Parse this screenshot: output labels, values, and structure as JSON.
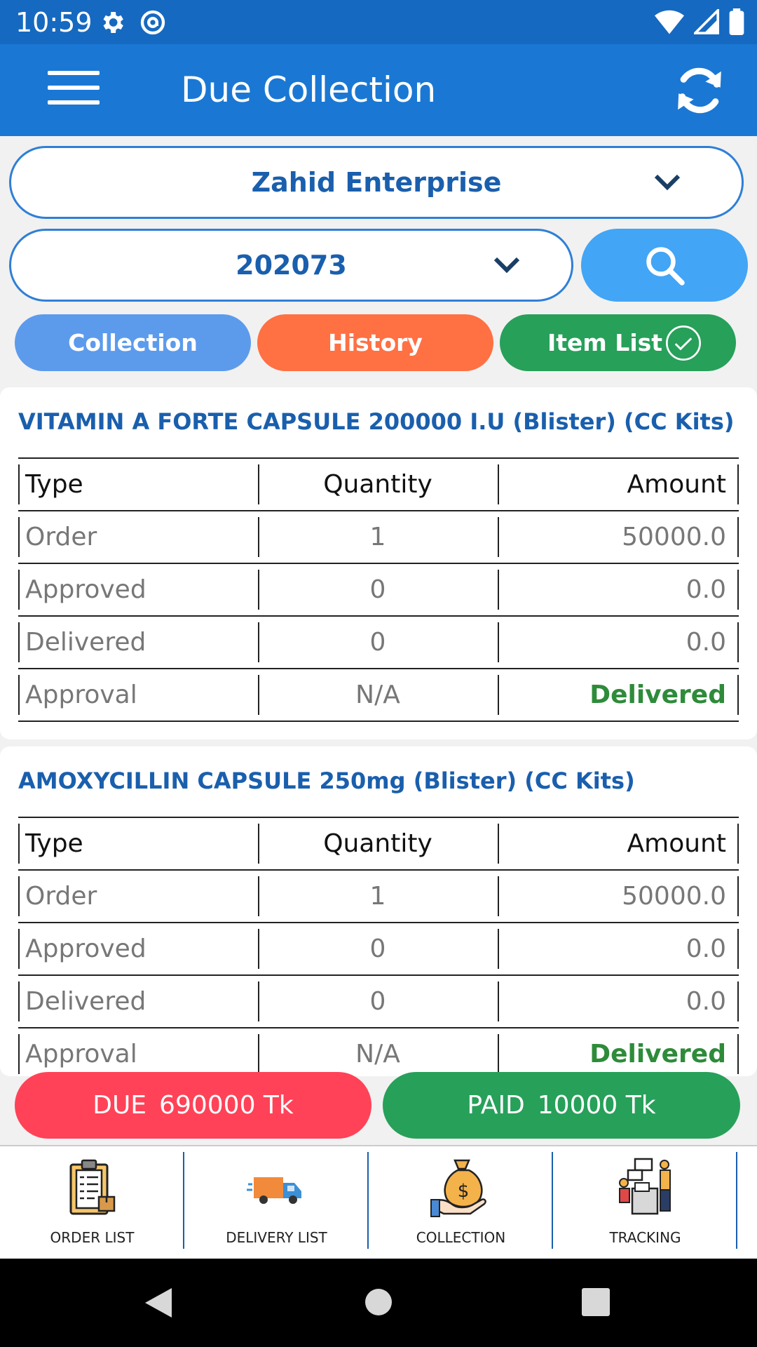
{
  "status_bar": {
    "time": "10:59"
  },
  "app_bar": {
    "title": "Due Collection"
  },
  "filters": {
    "company": "Zahid Enterprise",
    "code": "202073"
  },
  "tabs": [
    {
      "label": "Collection"
    },
    {
      "label": "History"
    },
    {
      "label": "Item List"
    }
  ],
  "items": [
    {
      "title": "VITAMIN A FORTE CAPSULE 200000 I.U (Blister) (CC Kits)",
      "header": {
        "type": "Type",
        "quantity": "Quantity",
        "amount": "Amount"
      },
      "rows": [
        {
          "type": "Order",
          "quantity": "1",
          "amount": "50000.0"
        },
        {
          "type": "Approved",
          "quantity": "0",
          "amount": "0.0"
        },
        {
          "type": "Delivered",
          "quantity": "0",
          "amount": "0.0"
        },
        {
          "type": "Approval",
          "quantity": "N/A",
          "amount": "Delivered"
        }
      ]
    },
    {
      "title": "AMOXYCILLIN CAPSULE 250mg (Blister) (CC Kits)",
      "header": {
        "type": "Type",
        "quantity": "Quantity",
        "amount": "Amount"
      },
      "rows": [
        {
          "type": "Order",
          "quantity": "1",
          "amount": "50000.0"
        },
        {
          "type": "Approved",
          "quantity": "0",
          "amount": "0.0"
        },
        {
          "type": "Delivered",
          "quantity": "0",
          "amount": "0.0"
        },
        {
          "type": "Approval",
          "quantity": "N/A",
          "amount": "Delivered"
        }
      ]
    }
  ],
  "summary": {
    "due_label": "DUE",
    "due_value": "690000 Tk",
    "paid_label": "PAID",
    "paid_value": "10000 Tk"
  },
  "bottom_nav": [
    {
      "label": "ORDER LIST",
      "icon": "clipboard-icon"
    },
    {
      "label": "DELIVERY LIST",
      "icon": "truck-icon"
    },
    {
      "label": "COLLECTION",
      "icon": "money-bag-icon"
    },
    {
      "label": "TRACKING",
      "icon": "tracking-people-icon"
    }
  ],
  "colors": {
    "status_bar": "#1669c0",
    "app_bar": "#1a78d4",
    "primary_text": "#1a5fad",
    "collection_tab": "#5c9bec",
    "history_tab": "#ff7043",
    "item_list_tab": "#27a05a",
    "due": "#ff4257",
    "paid": "#27a05a",
    "delivered_text": "#2e8b3a"
  }
}
